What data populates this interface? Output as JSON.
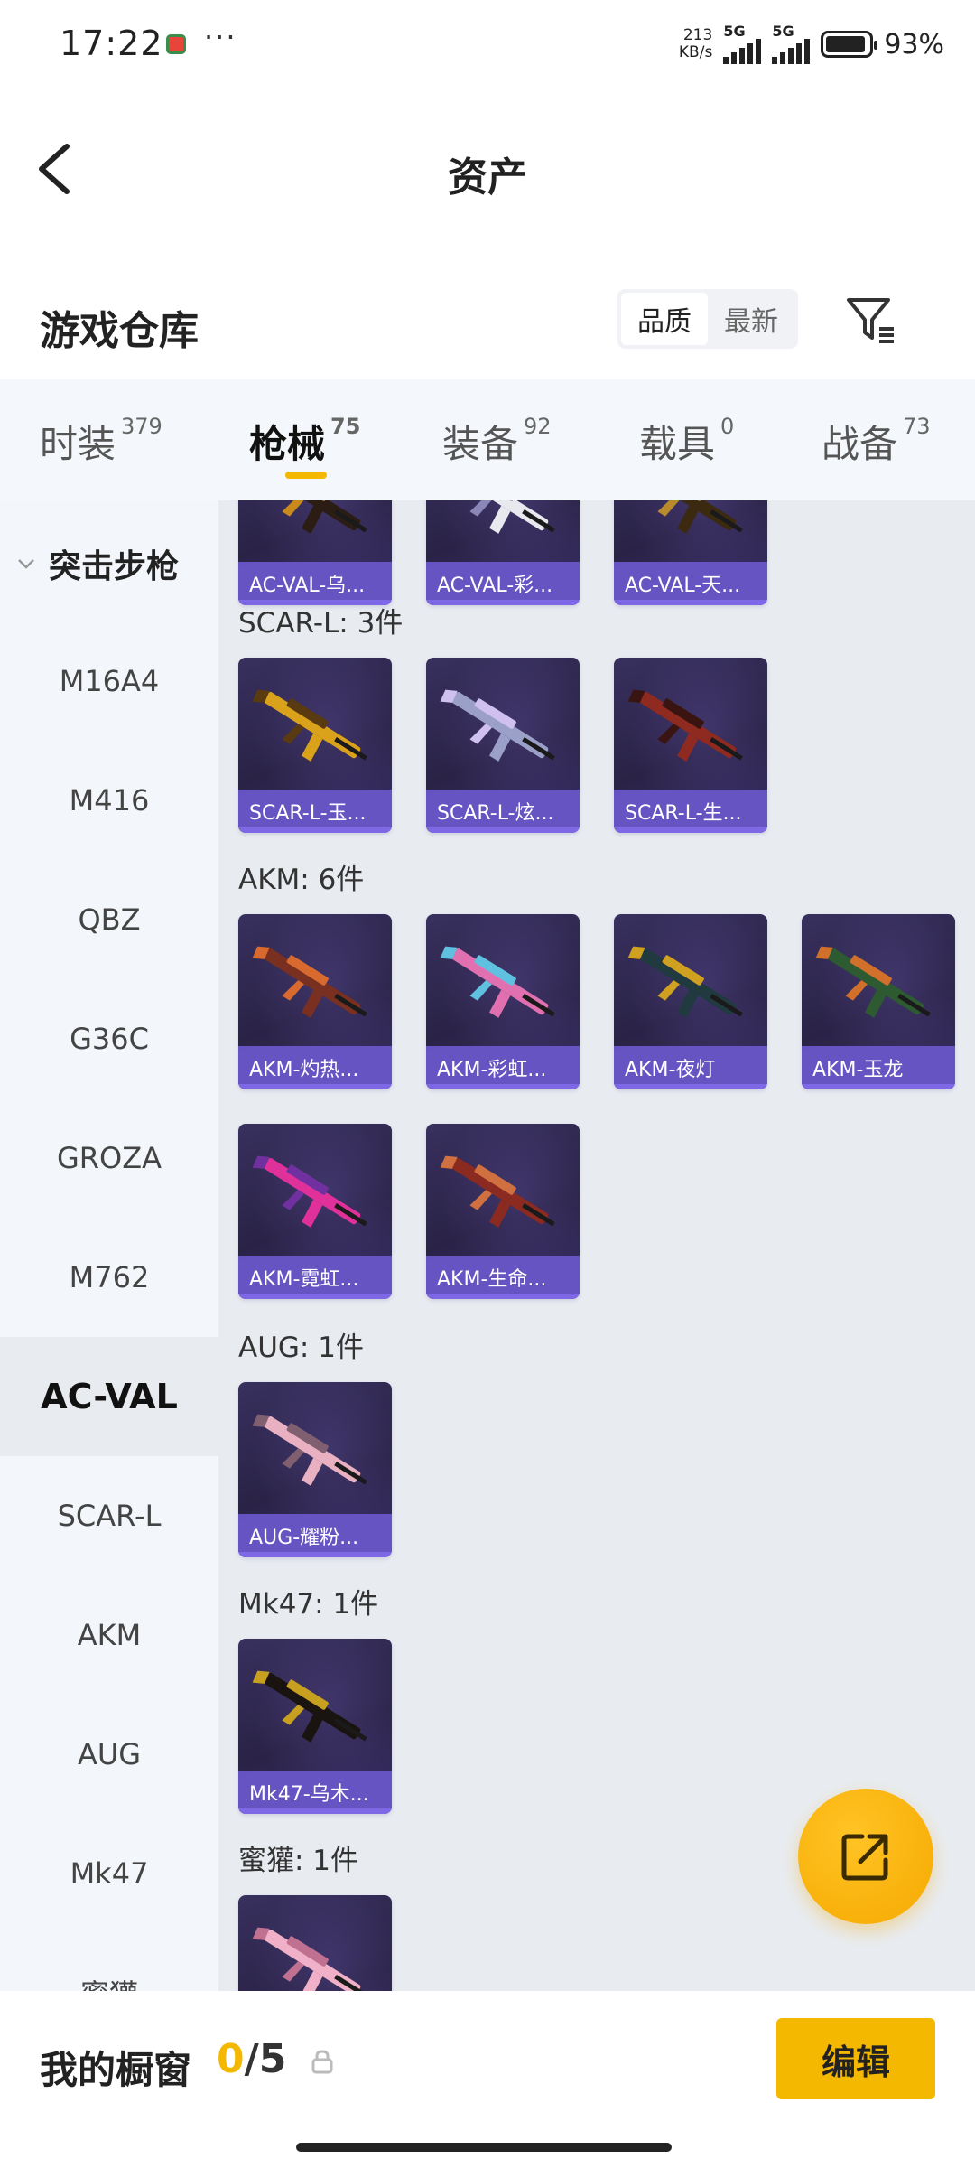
{
  "status_bar": {
    "time": "17:22",
    "net_speed_value": "213",
    "net_speed_unit": "KB/s",
    "sim1_label": "5G",
    "sim2_label": "5G",
    "battery_percent": "93%",
    "battery_level": 0.93
  },
  "header": {
    "title": "资产"
  },
  "section": {
    "title": "游戏仓库",
    "sort_options": [
      "品质",
      "最新"
    ],
    "sort_selected": "品质"
  },
  "tabs": [
    {
      "label": "时装",
      "count": "379"
    },
    {
      "label": "枪械",
      "count": "75",
      "active": true
    },
    {
      "label": "装备",
      "count": "92"
    },
    {
      "label": "载具",
      "count": "0"
    },
    {
      "label": "战备",
      "count": "73"
    }
  ],
  "sidebar": {
    "category": "突击步枪",
    "items": [
      "M16A4",
      "M416",
      "QBZ",
      "G36C",
      "GROZA",
      "M762",
      "AC-VAL",
      "SCAR-L",
      "AKM",
      "AUG",
      "Mk47",
      "蜜獾"
    ],
    "active_item": "AC-VAL"
  },
  "groups": [
    {
      "title": "",
      "items": [
        "AC-VAL-乌...",
        "AC-VAL-彩...",
        "AC-VAL-天..."
      ]
    },
    {
      "title": "SCAR-L: 3件",
      "items": [
        "SCAR-L-玉...",
        "SCAR-L-炫...",
        "SCAR-L-生..."
      ]
    },
    {
      "title": "AKM: 6件",
      "items": [
        "AKM-灼热...",
        "AKM-彩虹...",
        "AKM-夜灯",
        "AKM-玉龙",
        "AKM-霓虹...",
        "AKM-生命..."
      ]
    },
    {
      "title": "AUG: 1件",
      "items": [
        "AUG-耀粉..."
      ]
    },
    {
      "title": "Mk47: 1件",
      "items": [
        "Mk47-乌木..."
      ]
    },
    {
      "title": "蜜獾: 1件",
      "items": [
        ""
      ]
    }
  ],
  "bottom_bar": {
    "showcase_label": "我的橱窗",
    "showcase_current": "0",
    "showcase_total": "/5",
    "edit_label": "编辑"
  },
  "colors": {
    "accent": "#f5b800",
    "card_label_bg": "#6956c8",
    "card_bg": "#2a2346",
    "sidebar_bg": "#f3f6fa",
    "main_bg": "#e8ecf1"
  }
}
